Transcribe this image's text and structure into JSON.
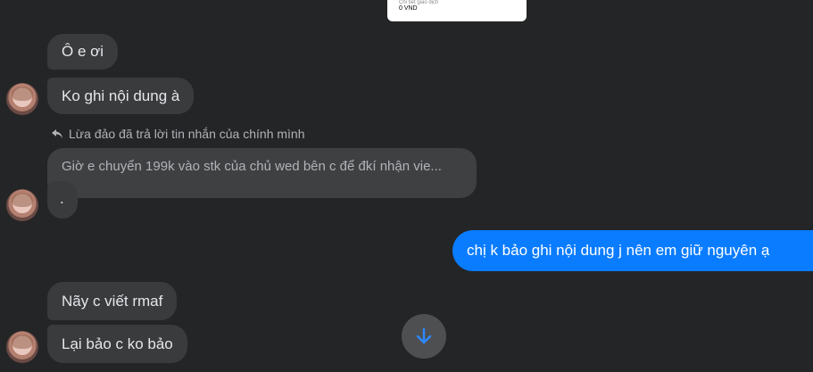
{
  "top_card": {
    "small_text": "Chi tiết giao dịch",
    "amount": "0 VND"
  },
  "messages": {
    "m1": "Ô e ơi",
    "m2": "Ko ghi nội dung à",
    "reply_note": "Lừa đảo đã trả lời tin nhắn của chính mình",
    "reply_quote": "Giờ e chuyển 199k vào stk của chủ wed bên c để đkí nhận vie...",
    "m3": ".",
    "outgoing": "chị k bảo ghi nội dung j nên em giữ nguyên ạ",
    "m4": "Nãy c viết rmaf",
    "m5": "Lại bảo c ko bảo"
  },
  "colors": {
    "background": "#242526",
    "incoming_bubble": "#3a3b3c",
    "outgoing_bubble": "#0a7cff"
  },
  "icons": {
    "reply": "reply-icon",
    "scroll_down": "arrow-down-icon"
  }
}
